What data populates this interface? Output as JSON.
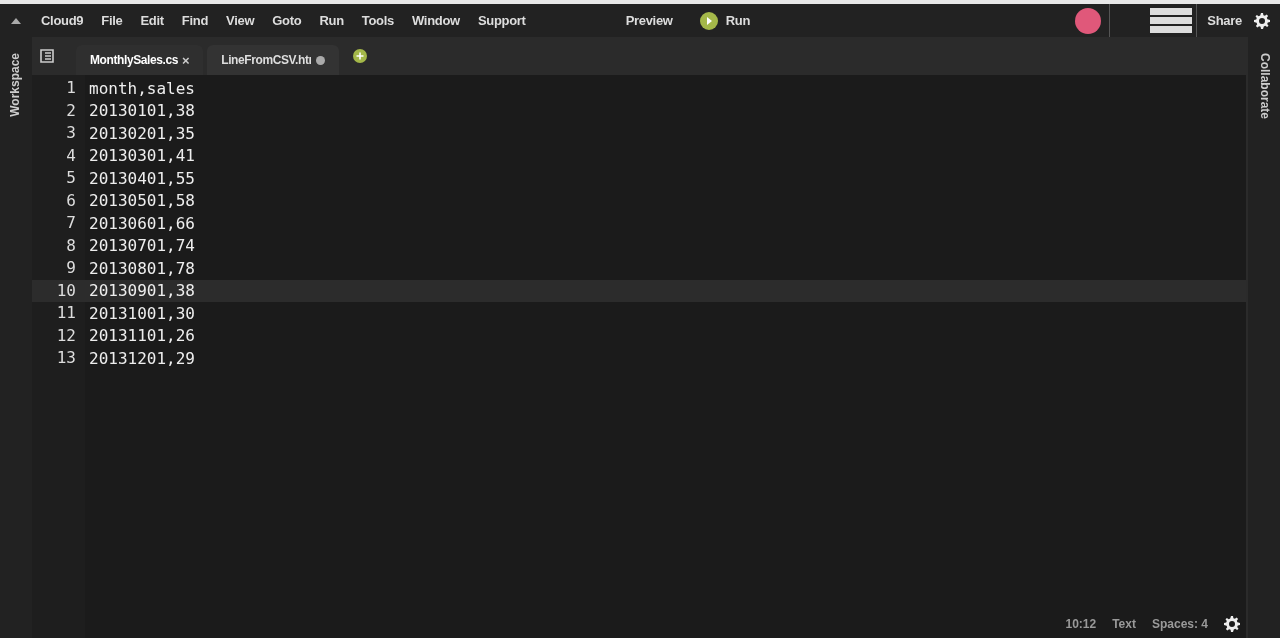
{
  "menu_bar": {
    "items": [
      "Cloud9",
      "File",
      "Edit",
      "Find",
      "View",
      "Goto",
      "Run",
      "Tools",
      "Window",
      "Support"
    ],
    "preview": "Preview",
    "run": "Run",
    "share": "Share"
  },
  "left_panel": {
    "label": "Workspace"
  },
  "right_panel": {
    "label": "Collaborate"
  },
  "tabs": [
    {
      "label": "MonthlySales.cs",
      "selected": true,
      "modified": false,
      "close": "×"
    },
    {
      "label": "LineFromCSV.htı",
      "selected": false,
      "modified": true
    }
  ],
  "editor": {
    "lines": [
      {
        "number": "1",
        "text": "month,sales",
        "active": false
      },
      {
        "number": "2",
        "text": "20130101,38",
        "active": false
      },
      {
        "number": "3",
        "text": "20130201,35",
        "active": false
      },
      {
        "number": "4",
        "text": "20130301,41",
        "active": false
      },
      {
        "number": "5",
        "text": "20130401,55",
        "active": false
      },
      {
        "number": "6",
        "text": "20130501,58",
        "active": false
      },
      {
        "number": "7",
        "text": "20130601,66",
        "active": false
      },
      {
        "number": "8",
        "text": "20130701,74",
        "active": false
      },
      {
        "number": "9",
        "text": "20130801,78",
        "active": false
      },
      {
        "number": "10",
        "text": "20130901,38",
        "active": true
      },
      {
        "number": "11",
        "text": "20131001,30",
        "active": false
      },
      {
        "number": "12",
        "text": "20131101,26",
        "active": false
      },
      {
        "number": "13",
        "text": "20131201,29",
        "active": false
      }
    ]
  },
  "status_bar": {
    "position": "10:12",
    "mode": "Text",
    "indent": "Spaces: 4"
  }
}
